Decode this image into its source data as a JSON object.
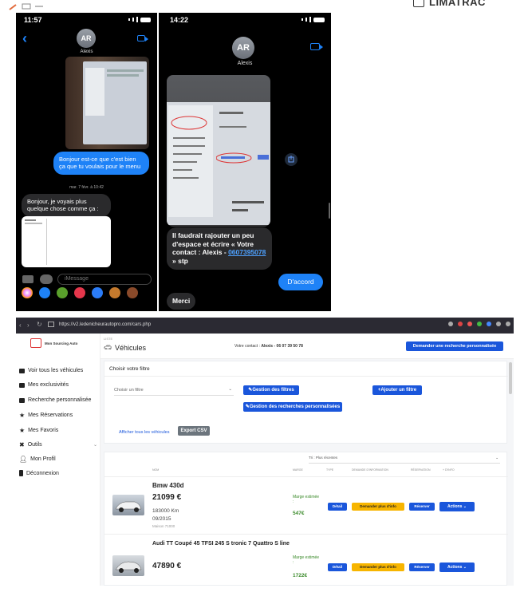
{
  "top_strip": {
    "logo_text": "LIMATRAC"
  },
  "phone1": {
    "time": "11:57",
    "contact_initials": "AR",
    "contact_name": "Alexis",
    "msg_out": "Bonjour est-ce que c'est bien ça que tu voulais pour le menu",
    "timestamp": "mar. 7 févr. à 10:42",
    "msg_in": "Bonjour, je voyais plus quelque chose comme ça :",
    "input_placeholder": "iMessage"
  },
  "phone2": {
    "time": "14:22",
    "contact_initials": "AR",
    "contact_name": "Alexis",
    "msg_in_1a": "Il faudrait rajouter un peu d'espace et écrire « Votre contact : Alexis - ",
    "msg_in_1_phone": "0607395078",
    "msg_in_1b": " » stp",
    "msg_out": "D'accord",
    "msg_in_2": "Merci"
  },
  "browser": {
    "url": "https://v2.ledenicheurautopro.com/cars.php",
    "logo": "Mon Sourcing Auto",
    "page_title": "Véhicules",
    "breadcrumb": "LISTE",
    "contact_prefix": "Votre contact : ",
    "contact_name": "Alexis",
    "contact_phone": " - 06 07 39 50 78",
    "request_button": "Demander une recherche personnalisée",
    "nav": [
      {
        "label": "Voir tous les véhicules",
        "icon": "car-icon"
      },
      {
        "label": "Mes exclusivités",
        "icon": "car-icon"
      },
      {
        "label": "Recherche personnalisée",
        "icon": "car-icon"
      },
      {
        "label": "Mes Réservations",
        "icon": "star-icon"
      },
      {
        "label": "Mes Favoris",
        "icon": "star-icon"
      },
      {
        "label": "Outils",
        "icon": "tools-icon"
      },
      {
        "label": "Mon Profil",
        "icon": "user-icon"
      },
      {
        "label": "Déconnexion",
        "icon": "logout-icon"
      }
    ],
    "filter_title": "Choisir votre filtre",
    "filter_placeholder": "Choisir un filtre",
    "manage_filters": "Gestion des filtres",
    "add_filter": "+Ajouter un filtre",
    "manage_searches": "Gestion des recherches personnalisées",
    "show_all": "Afficher tous les véhicules",
    "export_csv": "Export CSV",
    "sort_label": "Tri : Plus récentes",
    "columns": [
      "NOM",
      "MARGE",
      "TYPE",
      "DEMANDE D'INFORMATION",
      "RÉSERVATION",
      "+ D'INFO"
    ],
    "vehicles": [
      {
        "name": "Bmw 430d",
        "price": "21099 €",
        "km": "183000 Km",
        "date": "09/2015",
        "ref": "Maison 71000",
        "margin_label": "Marge estimée :",
        "margin_value": "547€"
      },
      {
        "name": "Audi TT Coupé 45 TFSI 245 S tronic 7 Quattro S line",
        "price": "47890 €",
        "margin_label": "Marge estimée :",
        "margin_value": "1722€"
      }
    ],
    "row_buttons": {
      "detail": "Détail",
      "info": "Demander plus d'info",
      "reserve": "Réserver",
      "actions": "Actions"
    }
  },
  "colors": {
    "imessage_blue": "#1e82f7",
    "primary": "#1a56db",
    "warning": "#f7b500"
  }
}
